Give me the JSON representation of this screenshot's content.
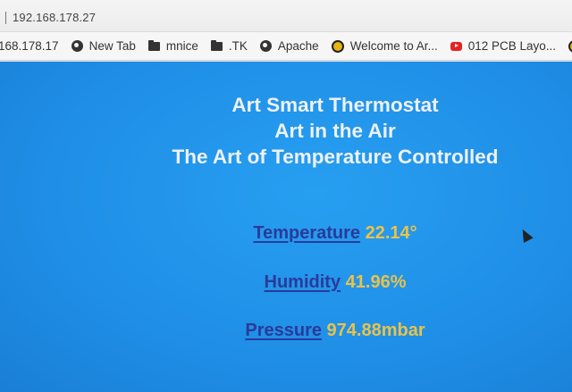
{
  "browser": {
    "url": "192.168.178.27",
    "bookmarks": [
      {
        "label": "168.178.17",
        "icon": "none"
      },
      {
        "label": "New Tab",
        "icon": "globe-icon"
      },
      {
        "label": "mnice",
        "icon": "folder-icon"
      },
      {
        "label": ".TK",
        "icon": "folder-icon"
      },
      {
        "label": "Apache",
        "icon": "globe-icon"
      },
      {
        "label": "Welcome to Ar...",
        "icon": "bee-icon"
      },
      {
        "label": "012 PCB Layo...",
        "icon": "youtube-icon"
      }
    ]
  },
  "page": {
    "title_line1": "Art Smart Thermostat",
    "title_line2": "Art in the Air",
    "title_line3": "The Art of Temperature Controlled",
    "temperature_label": "Temperature",
    "temperature_value": "22.14°",
    "humidity_label": "Humidity",
    "humidity_value": "41.96%",
    "pressure_label": "Pressure",
    "pressure_value": "974.88mbar"
  },
  "colors": {
    "page_background": "#1f8ee6",
    "title_text": "#eef1f7",
    "link_text": "#2a3a9a",
    "value_text": "#e9c24a"
  }
}
